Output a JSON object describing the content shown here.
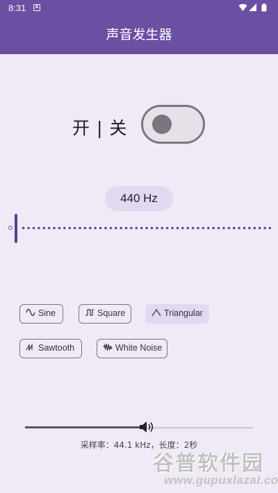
{
  "status_bar": {
    "time": "8:31",
    "notification_icon": "A"
  },
  "app_bar": {
    "title": "声音发生器"
  },
  "power": {
    "label": "开 | 关",
    "enabled": false
  },
  "frequency": {
    "display": "440 Hz",
    "slider_position": 0.0
  },
  "waveforms": {
    "selected": "Triangular",
    "options": [
      {
        "label": "Sine",
        "icon": "sine-wave-icon"
      },
      {
        "label": "Square",
        "icon": "square-wave-icon"
      },
      {
        "label": "Triangular",
        "icon": "triangle-wave-icon"
      },
      {
        "label": "Sawtooth",
        "icon": "sawtooth-wave-icon"
      },
      {
        "label": "White Noise",
        "icon": "noise-wave-icon"
      }
    ]
  },
  "volume": {
    "level": 0.52,
    "icon": "volume-icon"
  },
  "footer": {
    "info": "采样率：44.1 kHz，长度：2秒"
  },
  "watermark": {
    "title": "谷普软件园",
    "url": "www.gupuxlazal.com"
  },
  "colors": {
    "primary": "#6a4fa3",
    "background": "#f0eaf6",
    "chip_selected": "#e3d8f1",
    "outline": "#7a7480"
  }
}
